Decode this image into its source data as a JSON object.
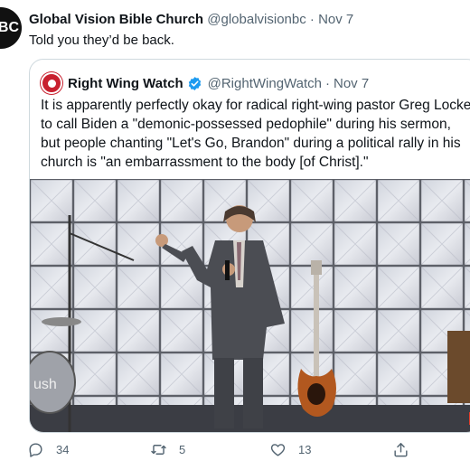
{
  "author": {
    "avatar_text": "BC",
    "name": "Global Vision Bible Church",
    "handle": "@globalvisionbc",
    "date": "Nov 7",
    "separator": "·"
  },
  "tweet_text": "Told you they’d be back.",
  "quoted": {
    "name": "Right Wing Watch",
    "handle": "@RightWingWatch",
    "date": "Nov 7",
    "separator": "·",
    "text": "It is apparently perfectly okay for radical right-wing pastor Greg Locke to call Biden a \"demonic-possessed pedophile\" during his sermon, but people chanting \"Let's Go, Brandon\" during a political rally in his church is \"an embarrassment to the body [of Christ].\"",
    "image_watermark": "ush"
  },
  "actions": {
    "reply_count": "34",
    "retweet_count": "5",
    "like_count": "13"
  },
  "colors": {
    "verified": "#1d9bf0",
    "muted": "#536471",
    "border": "#cfd9de"
  }
}
